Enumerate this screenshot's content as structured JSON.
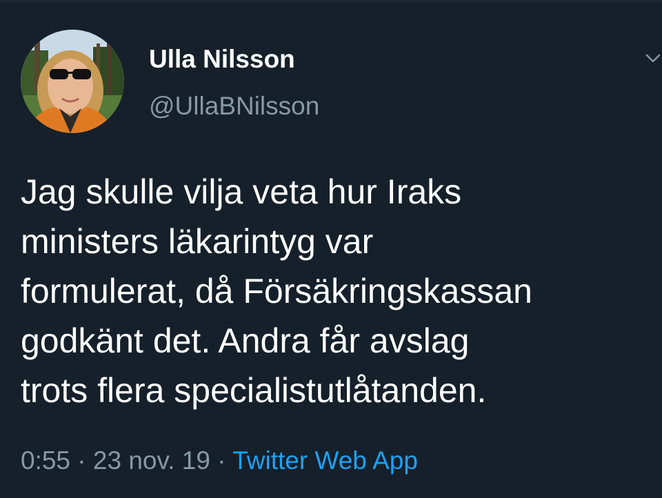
{
  "tweet": {
    "author": {
      "display_name": "Ulla Nilsson",
      "handle": "@UllaBNilsson",
      "avatar_icon": "user-avatar-photo"
    },
    "menu_icon": "chevron-down-icon",
    "text_lines": [
      "Jag skulle vilja veta hur Iraks",
      "ministers läkarintyg var",
      "formulerat, då Försäkringskassan",
      "godkänt det. Andra får avslag",
      "trots flera specialistutlåtanden."
    ],
    "time": "0:55",
    "separator": "·",
    "date": "23 nov. 19",
    "source": "Twitter Web App"
  },
  "colors": {
    "background": "#15202b",
    "text_primary": "#ffffff",
    "text_secondary": "#8899a6",
    "link": "#1da1f2"
  }
}
